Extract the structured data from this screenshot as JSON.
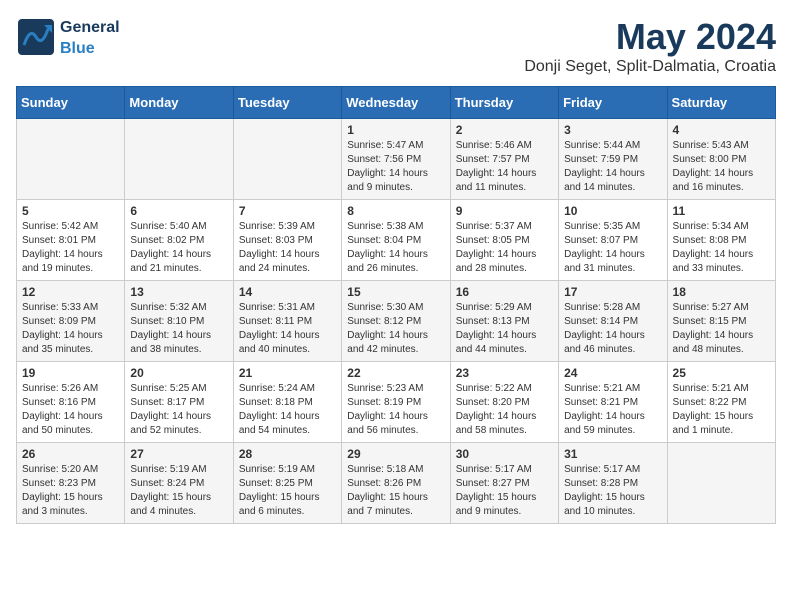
{
  "header": {
    "logo_general": "General",
    "logo_blue": "Blue",
    "month": "May 2024",
    "location": "Donji Seget, Split-Dalmatia, Croatia"
  },
  "days_of_week": [
    "Sunday",
    "Monday",
    "Tuesday",
    "Wednesday",
    "Thursday",
    "Friday",
    "Saturday"
  ],
  "weeks": [
    [
      {
        "day": "",
        "content": ""
      },
      {
        "day": "",
        "content": ""
      },
      {
        "day": "",
        "content": ""
      },
      {
        "day": "1",
        "content": "Sunrise: 5:47 AM\nSunset: 7:56 PM\nDaylight: 14 hours\nand 9 minutes."
      },
      {
        "day": "2",
        "content": "Sunrise: 5:46 AM\nSunset: 7:57 PM\nDaylight: 14 hours\nand 11 minutes."
      },
      {
        "day": "3",
        "content": "Sunrise: 5:44 AM\nSunset: 7:59 PM\nDaylight: 14 hours\nand 14 minutes."
      },
      {
        "day": "4",
        "content": "Sunrise: 5:43 AM\nSunset: 8:00 PM\nDaylight: 14 hours\nand 16 minutes."
      }
    ],
    [
      {
        "day": "5",
        "content": "Sunrise: 5:42 AM\nSunset: 8:01 PM\nDaylight: 14 hours\nand 19 minutes."
      },
      {
        "day": "6",
        "content": "Sunrise: 5:40 AM\nSunset: 8:02 PM\nDaylight: 14 hours\nand 21 minutes."
      },
      {
        "day": "7",
        "content": "Sunrise: 5:39 AM\nSunset: 8:03 PM\nDaylight: 14 hours\nand 24 minutes."
      },
      {
        "day": "8",
        "content": "Sunrise: 5:38 AM\nSunset: 8:04 PM\nDaylight: 14 hours\nand 26 minutes."
      },
      {
        "day": "9",
        "content": "Sunrise: 5:37 AM\nSunset: 8:05 PM\nDaylight: 14 hours\nand 28 minutes."
      },
      {
        "day": "10",
        "content": "Sunrise: 5:35 AM\nSunset: 8:07 PM\nDaylight: 14 hours\nand 31 minutes."
      },
      {
        "day": "11",
        "content": "Sunrise: 5:34 AM\nSunset: 8:08 PM\nDaylight: 14 hours\nand 33 minutes."
      }
    ],
    [
      {
        "day": "12",
        "content": "Sunrise: 5:33 AM\nSunset: 8:09 PM\nDaylight: 14 hours\nand 35 minutes."
      },
      {
        "day": "13",
        "content": "Sunrise: 5:32 AM\nSunset: 8:10 PM\nDaylight: 14 hours\nand 38 minutes."
      },
      {
        "day": "14",
        "content": "Sunrise: 5:31 AM\nSunset: 8:11 PM\nDaylight: 14 hours\nand 40 minutes."
      },
      {
        "day": "15",
        "content": "Sunrise: 5:30 AM\nSunset: 8:12 PM\nDaylight: 14 hours\nand 42 minutes."
      },
      {
        "day": "16",
        "content": "Sunrise: 5:29 AM\nSunset: 8:13 PM\nDaylight: 14 hours\nand 44 minutes."
      },
      {
        "day": "17",
        "content": "Sunrise: 5:28 AM\nSunset: 8:14 PM\nDaylight: 14 hours\nand 46 minutes."
      },
      {
        "day": "18",
        "content": "Sunrise: 5:27 AM\nSunset: 8:15 PM\nDaylight: 14 hours\nand 48 minutes."
      }
    ],
    [
      {
        "day": "19",
        "content": "Sunrise: 5:26 AM\nSunset: 8:16 PM\nDaylight: 14 hours\nand 50 minutes."
      },
      {
        "day": "20",
        "content": "Sunrise: 5:25 AM\nSunset: 8:17 PM\nDaylight: 14 hours\nand 52 minutes."
      },
      {
        "day": "21",
        "content": "Sunrise: 5:24 AM\nSunset: 8:18 PM\nDaylight: 14 hours\nand 54 minutes."
      },
      {
        "day": "22",
        "content": "Sunrise: 5:23 AM\nSunset: 8:19 PM\nDaylight: 14 hours\nand 56 minutes."
      },
      {
        "day": "23",
        "content": "Sunrise: 5:22 AM\nSunset: 8:20 PM\nDaylight: 14 hours\nand 58 minutes."
      },
      {
        "day": "24",
        "content": "Sunrise: 5:21 AM\nSunset: 8:21 PM\nDaylight: 14 hours\nand 59 minutes."
      },
      {
        "day": "25",
        "content": "Sunrise: 5:21 AM\nSunset: 8:22 PM\nDaylight: 15 hours\nand 1 minute."
      }
    ],
    [
      {
        "day": "26",
        "content": "Sunrise: 5:20 AM\nSunset: 8:23 PM\nDaylight: 15 hours\nand 3 minutes."
      },
      {
        "day": "27",
        "content": "Sunrise: 5:19 AM\nSunset: 8:24 PM\nDaylight: 15 hours\nand 4 minutes."
      },
      {
        "day": "28",
        "content": "Sunrise: 5:19 AM\nSunset: 8:25 PM\nDaylight: 15 hours\nand 6 minutes."
      },
      {
        "day": "29",
        "content": "Sunrise: 5:18 AM\nSunset: 8:26 PM\nDaylight: 15 hours\nand 7 minutes."
      },
      {
        "day": "30",
        "content": "Sunrise: 5:17 AM\nSunset: 8:27 PM\nDaylight: 15 hours\nand 9 minutes."
      },
      {
        "day": "31",
        "content": "Sunrise: 5:17 AM\nSunset: 8:28 PM\nDaylight: 15 hours\nand 10 minutes."
      },
      {
        "day": "",
        "content": ""
      }
    ]
  ]
}
